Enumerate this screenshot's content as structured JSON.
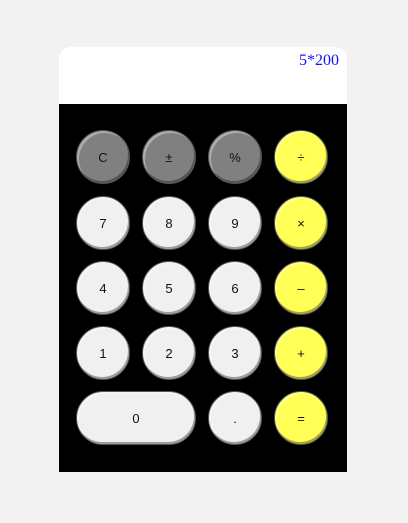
{
  "display": {
    "value": "5*200"
  },
  "keys": {
    "clear": "C",
    "plus_minus": "±",
    "percent": "%",
    "divide": "÷",
    "seven": "7",
    "eight": "8",
    "nine": "9",
    "multiply": "×",
    "four": "4",
    "five": "5",
    "six": "6",
    "subtract": "–",
    "one": "1",
    "two": "2",
    "three": "3",
    "add": "+",
    "zero": "0",
    "decimal": ".",
    "equals": "="
  },
  "colors": {
    "function_key": "#808080",
    "number_key": "#f0f0f0",
    "operator_key": "#ffff55",
    "display_text": "#1010ff",
    "keypad_background": "#000000"
  }
}
